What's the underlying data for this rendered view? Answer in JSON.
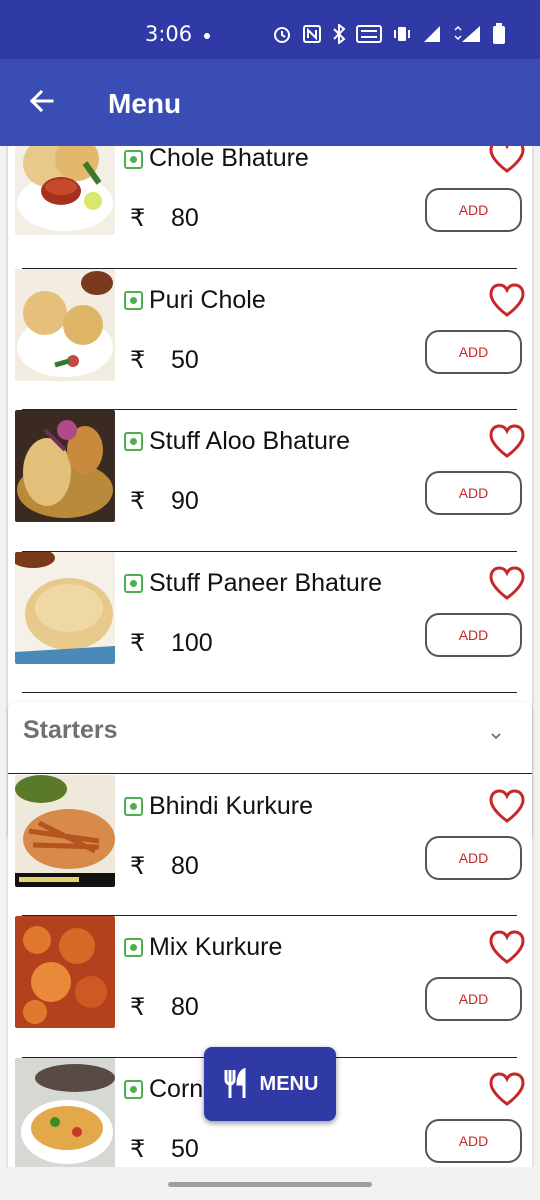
{
  "status_bar": {
    "time": "3:06"
  },
  "app_bar": {
    "title": "Menu"
  },
  "currency": "₹",
  "add_label": "ADD",
  "section_top_items": [
    {
      "name": "Chole Bhature",
      "price": "80",
      "image": "chole-bhature-photo"
    },
    {
      "name": "Puri Chole",
      "price": "50",
      "image": "puri-chole-photo"
    },
    {
      "name": "Stuff Aloo Bhature",
      "price": "90",
      "image": "stuff-aloo-bhature-photo"
    },
    {
      "name": "Stuff Paneer Bhature",
      "price": "100",
      "image": "stuff-paneer-bhature-photo"
    }
  ],
  "starters": {
    "title": "Starters",
    "items": [
      {
        "name": "Bhindi Kurkure",
        "price": "80",
        "image": "bhindi-kurkure-photo"
      },
      {
        "name": "Mix Kurkure",
        "price": "80",
        "image": "mix-kurkure-photo"
      },
      {
        "name": "Corn Chaat",
        "price": "50",
        "image": "corn-chaat-photo"
      }
    ]
  },
  "fab": {
    "label": "MENU"
  },
  "colors": {
    "primary_dark": "#2f3aa6",
    "primary": "#3a4db4",
    "heart": "#c62828",
    "veg": "#4caf50",
    "add_text": "#c62828"
  }
}
